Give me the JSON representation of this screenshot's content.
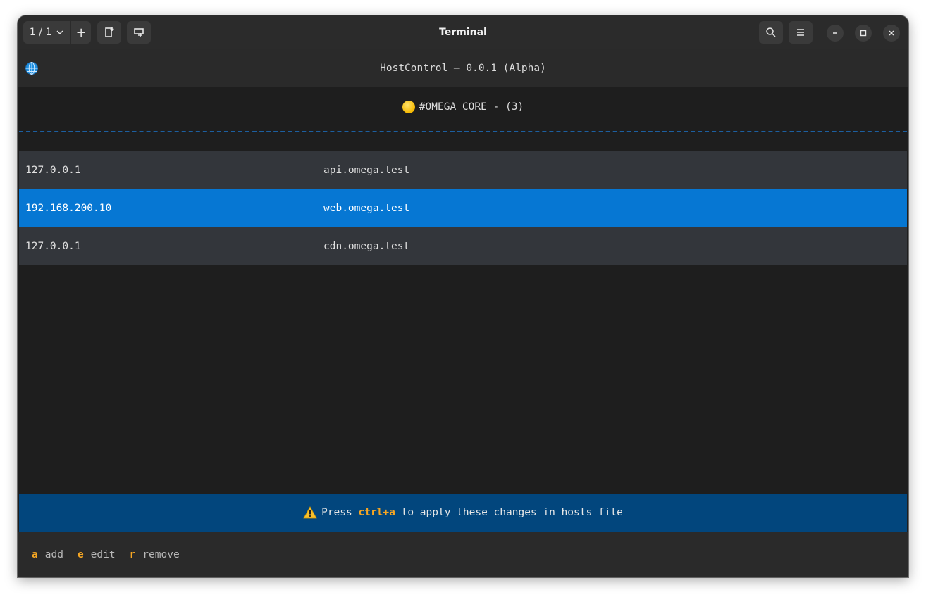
{
  "window": {
    "title": "Terminal",
    "tab_counter": "1 / 1",
    "tab_add": "+"
  },
  "app": {
    "title": "HostControl — 0.0.1 (Alpha)",
    "icon": "globe-icon"
  },
  "group": {
    "title": "#OMEGA CORE - (3)",
    "dot_color": "#f5b800"
  },
  "hosts": [
    {
      "ip": "127.0.0.1",
      "name": "api.omega.test",
      "selected": false
    },
    {
      "ip": "192.168.200.10",
      "name": "web.omega.test",
      "selected": true
    },
    {
      "ip": "127.0.0.1",
      "name": "cdn.omega.test",
      "selected": false
    }
  ],
  "notice": {
    "prefix": "Press",
    "key": "ctrl+a",
    "suffix": "to apply these changes in hosts file"
  },
  "shortcuts": [
    {
      "key": "a",
      "label": "add"
    },
    {
      "key": "e",
      "label": "edit"
    },
    {
      "key": "r",
      "label": "remove"
    }
  ],
  "colors": {
    "selected_row": "#0677d3",
    "row": "#33363b",
    "notice_bg": "#02467d",
    "accent_key": "#f5a623"
  }
}
